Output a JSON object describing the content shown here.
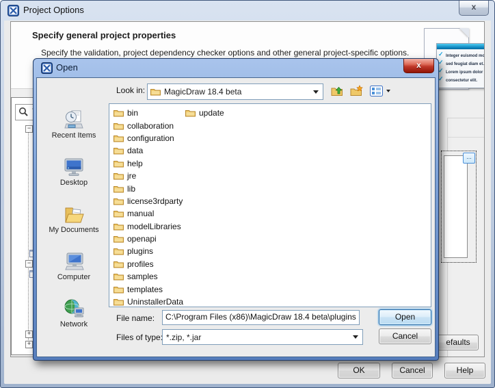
{
  "window": {
    "title": "Project Options",
    "close_glyph": "x"
  },
  "header": {
    "title": "Specify general project properties",
    "subtitle": "Specify the validation, project dependency checker options and other general project-specific options."
  },
  "illustration": {
    "checklist": [
      "Integer euismod mollis",
      "sed feugiat diam et.",
      "Lorem ipsum dolor",
      "consectetur elit."
    ],
    "check_glyph": "✓"
  },
  "options_tree": {
    "search_visible_text": "T"
  },
  "right_panel": {
    "browse_button": "..."
  },
  "background_buttons": {
    "defaults_partial": "efaults",
    "ok": "OK",
    "cancel": "Cancel",
    "help": "Help"
  },
  "open_dialog": {
    "title": "Open",
    "close_glyph": "x",
    "look_in_label": "Look in:",
    "look_in_value": "MagicDraw 18.4 beta",
    "toolbar_icons": [
      "up-one-level-icon",
      "new-folder-icon",
      "view-menu-icon"
    ],
    "sidebar": [
      "Recent Items",
      "Desktop",
      "My Documents",
      "Computer",
      "Network"
    ],
    "folders_col1": [
      "bin",
      "collaboration",
      "configuration",
      "data",
      "help",
      "jre",
      "lib",
      "license3rdparty",
      "manual",
      "modelLibraries",
      "openapi",
      "plugins",
      "profiles",
      "samples",
      "templates",
      "UninstallerData"
    ],
    "folders_col2": [
      "update"
    ],
    "selected_folder": "bin",
    "file_name_label": "File name:",
    "file_name_value": "C:\\Program Files (x86)\\MagicDraw 18.4 beta\\plugins",
    "files_of_type_label": "Files of type:",
    "files_of_type_value": "*.zip, *.jar",
    "open_button": "Open",
    "cancel_button": "Cancel"
  },
  "colors": {
    "open_titlebar_blue": "#6f96cc",
    "po_titlebar_silver": "#c5d2e4",
    "close_red": "#c0392b",
    "folder_yellow": "#efc868",
    "default_button_ring": "#7ab8e8",
    "check_blue": "#18a2dc"
  }
}
